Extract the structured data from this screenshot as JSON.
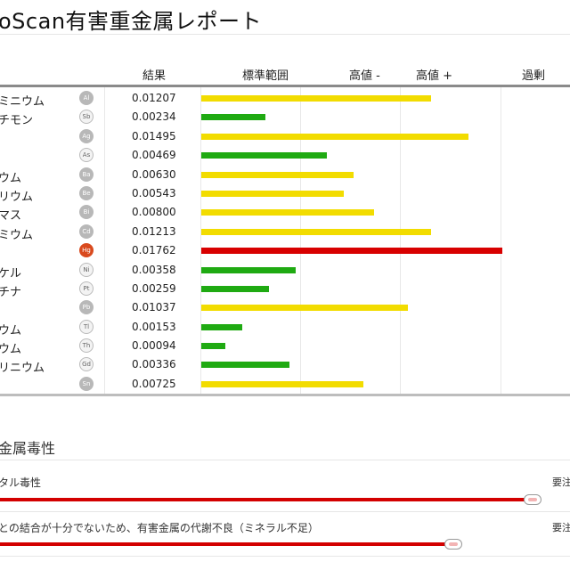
{
  "report": {
    "title": "oScan有害重金属レポート"
  },
  "columns": {
    "result": "結果",
    "range": "標準範囲",
    "high_minus": "高値 -",
    "high_plus": "高値 +",
    "excess": "過剰"
  },
  "colors": {
    "yellow": "#f2dc00",
    "green": "#1faa12",
    "red": "#d80000"
  },
  "metals": [
    {
      "name": "ミニウム",
      "symbol": "Al",
      "value": "0.01207",
      "level": 0.68,
      "status": "yellow",
      "badge": "gray"
    },
    {
      "name": "チモン",
      "symbol": "Sb",
      "value": "0.00234",
      "level": 0.19,
      "status": "green",
      "badge": "outline"
    },
    {
      "name": "",
      "symbol": "Ag",
      "value": "0.01495",
      "level": 0.79,
      "status": "yellow",
      "badge": "gray"
    },
    {
      "name": "",
      "symbol": "As",
      "value": "0.00469",
      "level": 0.37,
      "status": "green",
      "badge": "outline"
    },
    {
      "name": "ウム",
      "symbol": "Ba",
      "value": "0.00630",
      "level": 0.45,
      "status": "yellow",
      "badge": "gray"
    },
    {
      "name": "リウム",
      "symbol": "Be",
      "value": "0.00543",
      "level": 0.42,
      "status": "yellow",
      "badge": "gray"
    },
    {
      "name": "マス",
      "symbol": "Bi",
      "value": "0.00800",
      "level": 0.51,
      "status": "yellow",
      "badge": "gray"
    },
    {
      "name": "ミウム",
      "symbol": "Cd",
      "value": "0.01213",
      "level": 0.68,
      "status": "yellow",
      "badge": "gray"
    },
    {
      "name": "",
      "symbol": "Hg",
      "value": "0.01762",
      "level": 0.89,
      "status": "red",
      "badge": "red"
    },
    {
      "name": "ケル",
      "symbol": "Ni",
      "value": "0.00358",
      "level": 0.28,
      "status": "green",
      "badge": "outline"
    },
    {
      "name": "チナ",
      "symbol": "Pt",
      "value": "0.00259",
      "level": 0.2,
      "status": "green",
      "badge": "outline"
    },
    {
      "name": "",
      "symbol": "Pb",
      "value": "0.01037",
      "level": 0.61,
      "status": "yellow",
      "badge": "gray"
    },
    {
      "name": "ウム",
      "symbol": "Tl",
      "value": "0.00153",
      "level": 0.12,
      "status": "green",
      "badge": "outline"
    },
    {
      "name": "ウム",
      "symbol": "Th",
      "value": "0.00094",
      "level": 0.07,
      "status": "green",
      "badge": "outline"
    },
    {
      "name": "リニウム",
      "symbol": "Gd",
      "value": "0.00336",
      "level": 0.26,
      "status": "green",
      "badge": "outline"
    },
    {
      "name": "",
      "symbol": "Sn",
      "value": "0.00725",
      "level": 0.48,
      "status": "yellow",
      "badge": "gray"
    }
  ],
  "toxicity": {
    "title": "金属毒性",
    "items": [
      {
        "label": "タル毒性",
        "right": "要注",
        "level": 0.935
      },
      {
        "label": "との結合が十分でないため、有害金属の代謝不良（ミネラル不足）",
        "right": "要注",
        "level": 0.795
      }
    ]
  }
}
